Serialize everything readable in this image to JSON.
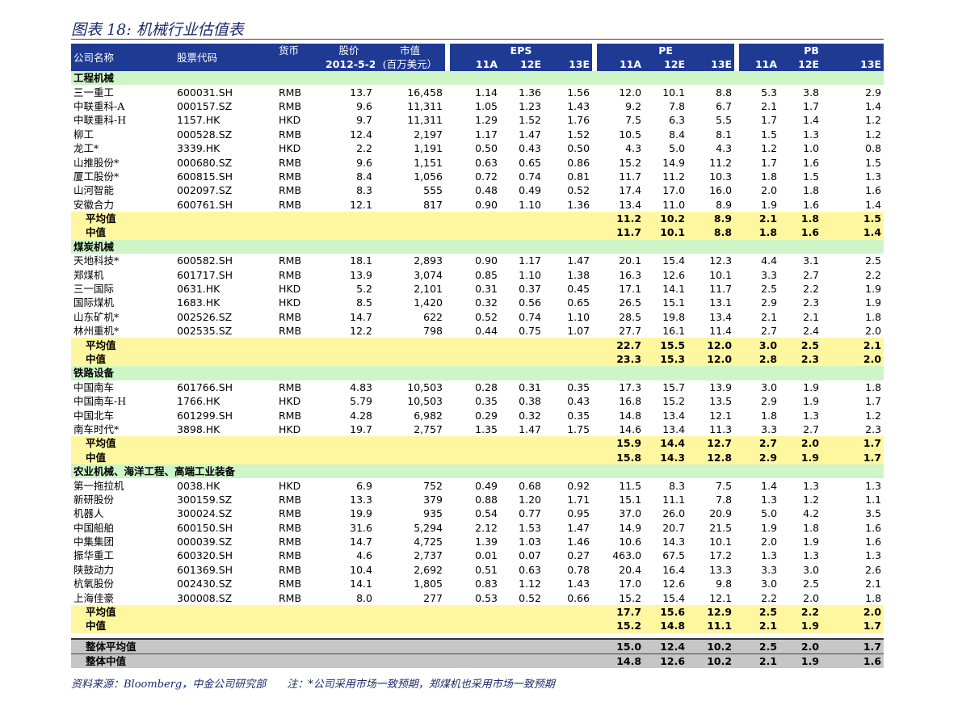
{
  "title": "图表 18: 机械行业估值表",
  "header": {
    "company": "公司名称",
    "code": "股票代码",
    "currency": "货币",
    "price": "股价",
    "price_date": "2012-5-21",
    "mktcap": "市值",
    "mktcap_unit": "(百万美元）",
    "eps": "EPS",
    "pe": "PE",
    "pb": "PB",
    "years": [
      "11A",
      "12E",
      "13E"
    ]
  },
  "sections": [
    {
      "name": "工程机械",
      "rows": [
        [
          "三一重工",
          "600031.SH",
          "RMB",
          "13.7",
          "16,458",
          "1.14",
          "1.36",
          "1.56",
          "12.0",
          "10.1",
          "8.8",
          "5.3",
          "3.8",
          "2.9"
        ],
        [
          "中联重科-A",
          "000157.SZ",
          "RMB",
          "9.6",
          "11,311",
          "1.05",
          "1.23",
          "1.43",
          "9.2",
          "7.8",
          "6.7",
          "2.1",
          "1.7",
          "1.4"
        ],
        [
          "中联重科-H",
          "1157.HK",
          "HKD",
          "9.7",
          "11,311",
          "1.29",
          "1.52",
          "1.76",
          "7.5",
          "6.3",
          "5.5",
          "1.7",
          "1.4",
          "1.2"
        ],
        [
          "柳工",
          "000528.SZ",
          "RMB",
          "12.4",
          "2,197",
          "1.17",
          "1.47",
          "1.52",
          "10.5",
          "8.4",
          "8.1",
          "1.5",
          "1.3",
          "1.2"
        ],
        [
          "龙工*",
          "3339.HK",
          "HKD",
          "2.2",
          "1,191",
          "0.50",
          "0.43",
          "0.50",
          "4.3",
          "5.0",
          "4.3",
          "1.2",
          "1.0",
          "0.8"
        ],
        [
          "山推股份*",
          "000680.SZ",
          "RMB",
          "9.6",
          "1,151",
          "0.63",
          "0.65",
          "0.86",
          "15.2",
          "14.9",
          "11.2",
          "1.7",
          "1.6",
          "1.5"
        ],
        [
          "厦工股份*",
          "600815.SH",
          "RMB",
          "8.4",
          "1,056",
          "0.72",
          "0.74",
          "0.81",
          "11.7",
          "11.2",
          "10.3",
          "1.8",
          "1.5",
          "1.3"
        ],
        [
          "山河智能",
          "002097.SZ",
          "RMB",
          "8.3",
          "555",
          "0.48",
          "0.49",
          "0.52",
          "17.4",
          "17.0",
          "16.0",
          "2.0",
          "1.8",
          "1.6"
        ],
        [
          "安徽合力",
          "600761.SH",
          "RMB",
          "12.1",
          "817",
          "0.90",
          "1.10",
          "1.36",
          "13.4",
          "11.0",
          "8.9",
          "1.9",
          "1.6",
          "1.4"
        ]
      ],
      "avg": [
        "平均值",
        "11.2",
        "10.2",
        "8.9",
        "2.1",
        "1.8",
        "1.5"
      ],
      "median": [
        "中值",
        "11.7",
        "10.1",
        "8.8",
        "1.8",
        "1.6",
        "1.4"
      ]
    },
    {
      "name": "煤炭机械",
      "rows": [
        [
          "天地科技*",
          "600582.SH",
          "RMB",
          "18.1",
          "2,893",
          "0.90",
          "1.17",
          "1.47",
          "20.1",
          "15.4",
          "12.3",
          "4.4",
          "3.1",
          "2.5"
        ],
        [
          "郑煤机",
          "601717.SH",
          "RMB",
          "13.9",
          "3,074",
          "0.85",
          "1.10",
          "1.38",
          "16.3",
          "12.6",
          "10.1",
          "3.3",
          "2.7",
          "2.2"
        ],
        [
          "三一国际",
          "0631.HK",
          "HKD",
          "5.2",
          "2,101",
          "0.31",
          "0.37",
          "0.45",
          "17.1",
          "14.1",
          "11.7",
          "2.5",
          "2.2",
          "1.9"
        ],
        [
          "国际煤机",
          "1683.HK",
          "HKD",
          "8.5",
          "1,420",
          "0.32",
          "0.56",
          "0.65",
          "26.5",
          "15.1",
          "13.1",
          "2.9",
          "2.3",
          "1.9"
        ],
        [
          "山东矿机*",
          "002526.SZ",
          "RMB",
          "14.7",
          "622",
          "0.52",
          "0.74",
          "1.10",
          "28.5",
          "19.8",
          "13.4",
          "2.1",
          "2.1",
          "1.8"
        ],
        [
          "林州重机*",
          "002535.SZ",
          "RMB",
          "12.2",
          "798",
          "0.44",
          "0.75",
          "1.07",
          "27.7",
          "16.1",
          "11.4",
          "2.7",
          "2.4",
          "2.0"
        ]
      ],
      "avg": [
        "平均值",
        "22.7",
        "15.5",
        "12.0",
        "3.0",
        "2.5",
        "2.1"
      ],
      "median": [
        "中值",
        "23.3",
        "15.3",
        "12.0",
        "2.8",
        "2.3",
        "2.0"
      ]
    },
    {
      "name": "铁路设备",
      "rows": [
        [
          "中国南车",
          "601766.SH",
          "RMB",
          "4.83",
          "10,503",
          "0.28",
          "0.31",
          "0.35",
          "17.3",
          "15.7",
          "13.9",
          "3.0",
          "1.9",
          "1.8"
        ],
        [
          "中国南车-H",
          "1766.HK",
          "HKD",
          "5.79",
          "10,503",
          "0.35",
          "0.38",
          "0.43",
          "16.8",
          "15.2",
          "13.5",
          "2.9",
          "1.9",
          "1.7"
        ],
        [
          "中国北车",
          "601299.SH",
          "RMB",
          "4.28",
          "6,982",
          "0.29",
          "0.32",
          "0.35",
          "14.8",
          "13.4",
          "12.1",
          "1.8",
          "1.3",
          "1.2"
        ],
        [
          "南车时代*",
          "3898.HK",
          "HKD",
          "19.7",
          "2,757",
          "1.35",
          "1.47",
          "1.75",
          "14.6",
          "13.4",
          "11.3",
          "3.3",
          "2.7",
          "2.3"
        ]
      ],
      "avg": [
        "平均值",
        "15.9",
        "14.4",
        "12.7",
        "2.7",
        "2.0",
        "1.7"
      ],
      "median": [
        "中值",
        "15.8",
        "14.3",
        "12.8",
        "2.9",
        "1.9",
        "1.7"
      ]
    },
    {
      "name": "农业机械、海洋工程、高端工业装备",
      "rows": [
        [
          "第一拖拉机",
          "0038.HK",
          "HKD",
          "6.9",
          "752",
          "0.49",
          "0.68",
          "0.92",
          "11.5",
          "8.3",
          "7.5",
          "1.4",
          "1.3",
          "1.3"
        ],
        [
          "新研股份",
          "300159.SZ",
          "RMB",
          "13.3",
          "379",
          "0.88",
          "1.20",
          "1.71",
          "15.1",
          "11.1",
          "7.8",
          "1.3",
          "1.2",
          "1.1"
        ],
        [
          "机器人",
          "300024.SZ",
          "RMB",
          "19.9",
          "935",
          "0.54",
          "0.77",
          "0.95",
          "37.0",
          "26.0",
          "20.9",
          "5.0",
          "4.2",
          "3.5"
        ],
        [
          "中国船舶",
          "600150.SH",
          "RMB",
          "31.6",
          "5,294",
          "2.12",
          "1.53",
          "1.47",
          "14.9",
          "20.7",
          "21.5",
          "1.9",
          "1.8",
          "1.6"
        ],
        [
          "中集集团",
          "000039.SZ",
          "RMB",
          "14.7",
          "4,725",
          "1.39",
          "1.03",
          "1.46",
          "10.6",
          "14.3",
          "10.1",
          "2.0",
          "1.9",
          "1.6"
        ],
        [
          "振华重工",
          "600320.SH",
          "RMB",
          "4.6",
          "2,737",
          "0.01",
          "0.07",
          "0.27",
          "463.0",
          "67.5",
          "17.2",
          "1.3",
          "1.3",
          "1.3"
        ],
        [
          "陕鼓动力",
          "601369.SH",
          "RMB",
          "10.4",
          "2,692",
          "0.51",
          "0.63",
          "0.78",
          "20.4",
          "16.4",
          "13.3",
          "3.3",
          "3.0",
          "2.6"
        ],
        [
          "杭氧股份",
          "002430.SZ",
          "RMB",
          "14.1",
          "1,805",
          "0.83",
          "1.12",
          "1.43",
          "17.0",
          "12.6",
          "9.8",
          "3.0",
          "2.5",
          "2.1"
        ],
        [
          "上海佳豪",
          "300008.SZ",
          "RMB",
          "8.0",
          "277",
          "0.53",
          "0.52",
          "0.66",
          "15.2",
          "15.4",
          "12.1",
          "2.2",
          "2.0",
          "1.8"
        ]
      ],
      "avg": [
        "平均值",
        "17.7",
        "15.6",
        "12.9",
        "2.5",
        "2.2",
        "2.0"
      ],
      "median": [
        "中值",
        "15.2",
        "14.8",
        "11.1",
        "2.1",
        "1.9",
        "1.7"
      ]
    }
  ],
  "totals": [
    [
      "整体平均值",
      "15.0",
      "12.4",
      "10.2",
      "2.5",
      "2.0",
      "1.7"
    ],
    [
      "整体中值",
      "14.8",
      "12.6",
      "10.2",
      "2.1",
      "1.9",
      "1.6"
    ]
  ],
  "footer": {
    "source": "资料来源：Bloomberg，中金公司研究部",
    "note": "注：*公司采用市场一致预期，郑煤机也采用市场一致预期"
  },
  "colors": {
    "header_bg": "#1f3a93",
    "section_bg": "#cdf5c6",
    "average_bg": "#fff7a0",
    "total_bg": "#c6c6c6",
    "title_color": "#1b2a6b"
  }
}
